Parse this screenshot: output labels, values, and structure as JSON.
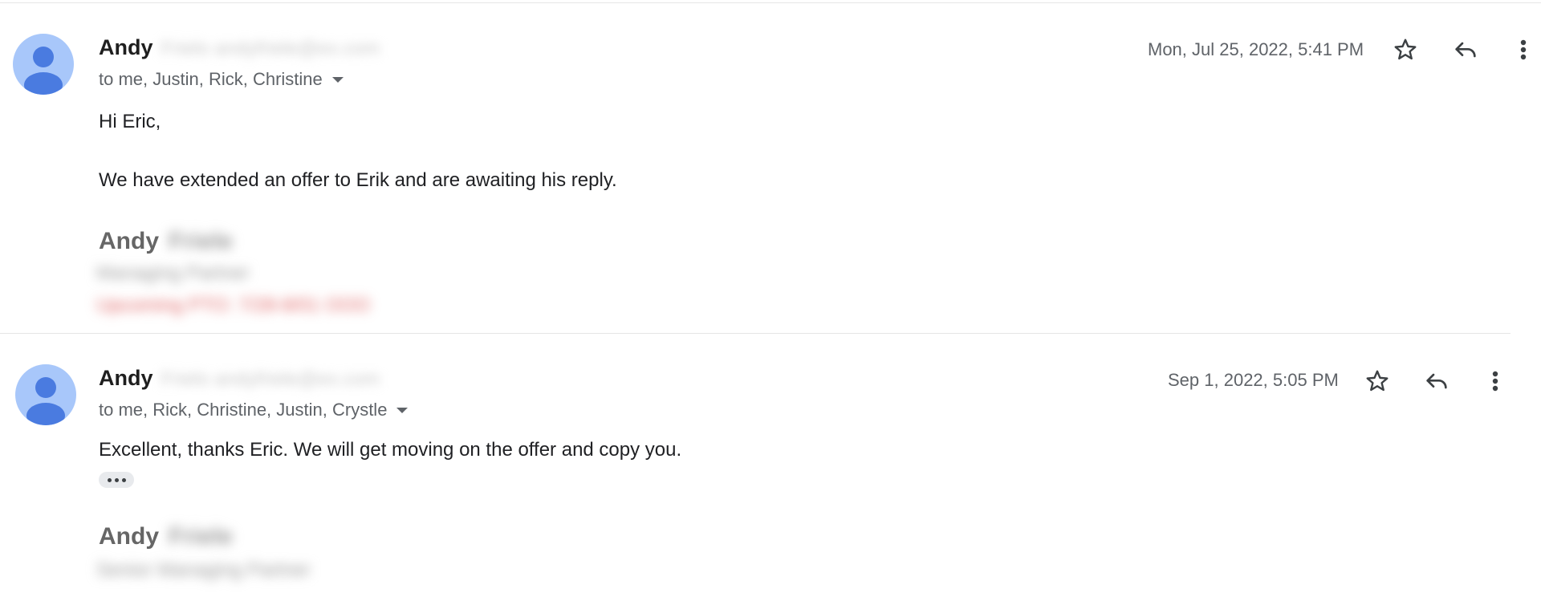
{
  "messages": [
    {
      "sender_name": "Andy",
      "sender_email_redacted": "Frielo andyfriele@ex.com",
      "recipients": "to me, Justin, Rick, Christine",
      "timestamp": "Mon, Jul 25, 2022, 5:41 PM",
      "body": [
        "Hi Eric,",
        "We have extended an offer to Erik and are awaiting his reply."
      ],
      "signature": {
        "first_name": "Andy",
        "last_name_redacted": "Friele",
        "line1_redacted": "Managing Partner",
        "line2_redacted": "Upcoming PTO: 7/28-8/01 OOO"
      }
    },
    {
      "sender_name": "Andy",
      "sender_email_redacted": "Frielo andyfriele@ex.com",
      "recipients": "to me, Rick, Christine, Justin, Crystle",
      "timestamp": "Sep 1, 2022, 5:05 PM",
      "body": [
        "Excellent, thanks Eric.  We will get moving on the offer and copy you."
      ],
      "signature": {
        "first_name": "Andy",
        "last_name_redacted": "Friele",
        "line1_redacted": "Senior Managing Partner"
      }
    }
  ],
  "icons": {
    "avatar": "person-avatar-icon",
    "star": "star-icon",
    "reply": "reply-icon",
    "more": "more-vert-icon",
    "expand": "chevron-down-icon",
    "trimmed": "show-trimmed-content-icon"
  },
  "colors": {
    "avatar_bg": "#a8c7fa",
    "avatar_fg": "#4a7be0",
    "signature_red": "#e06666"
  }
}
